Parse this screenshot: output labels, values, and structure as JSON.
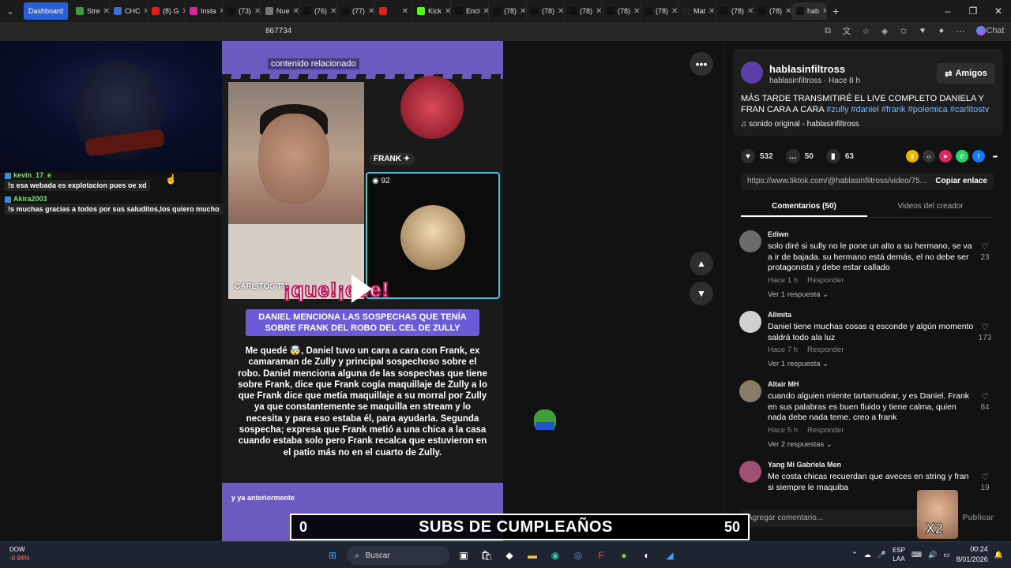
{
  "browser": {
    "tabs": [
      {
        "label": "Dashboard",
        "group": true,
        "color": "#2b5fd9"
      },
      {
        "label": "Stre",
        "color": "#3a9d3a"
      },
      {
        "label": "CHC",
        "color": "#3a6fd8"
      },
      {
        "label": "(8) G",
        "color": "#e02020"
      },
      {
        "label": "Insta",
        "color": "#d6249f"
      },
      {
        "label": "(73)",
        "color": "#111111"
      },
      {
        "label": "Nue",
        "color": "#777777"
      },
      {
        "label": "(76)",
        "color": "#111111"
      },
      {
        "label": "(77)",
        "color": "#111111"
      },
      {
        "label": "",
        "color": "#e02020"
      },
      {
        "label": "Kick",
        "color": "#53fc18"
      },
      {
        "label": "Enci",
        "color": "#111111"
      },
      {
        "label": "(78)",
        "color": "#111111"
      },
      {
        "label": "(78)",
        "color": "#111111"
      },
      {
        "label": "(78)",
        "color": "#111111"
      },
      {
        "label": "(78)",
        "color": "#111111"
      },
      {
        "label": "(78)",
        "color": "#111111"
      },
      {
        "label": "Mat",
        "color": "#222222"
      },
      {
        "label": "(78)",
        "color": "#111111"
      },
      {
        "label": "(78)",
        "color": "#111111"
      },
      {
        "label": "hab",
        "active": true,
        "color": "#111111"
      }
    ],
    "url_fragment": "867734",
    "chat_label": "Chat"
  },
  "stream_chat": [
    {
      "user": "kevin_17_e",
      "message": "!s esa webada es explotacion pues oe xd"
    },
    {
      "user": "Akira2003",
      "message": "!s muchas gracias a todos por sus saluditos,los quiero mucho"
    }
  ],
  "video": {
    "related_label": "contenido relacionado",
    "streamer_label": "CARLITOS TV",
    "frank_label": "FRANK",
    "viewer_count": "92",
    "sticker": "¡que!¡eee!",
    "headline": "DANIEL MENCIONA LAS SOSPECHAS QUE TENÍA SOBRE FRANK DEL ROBO DEL CEL DE ZULLY",
    "body": "Me quedé 🤯, Daniel tuvo un cara a cara con Frank, ex camaraman de Zully y principal sospechoso sobre el robo. Daniel menciona alguna de las sospechas que tiene sobre Frank, dice que Frank cogía maquillaje de Zully a lo que Frank dice que metía maquillaje a su morral por Zully ya que constantemente se maquilla en stream y lo necesita y para eso estaba él, para ayudarla. Segunda sospecha; expresa que Frank metió a una chica a la casa cuando estaba solo pero Frank recalca que estuvieron en el patio más no en el cuarto de Zully.",
    "bottom_text": "y ya anteriormente"
  },
  "subs_bar": {
    "left": "0",
    "title": "SUBS DE CUMPLEAÑOS",
    "right": "50"
  },
  "panel": {
    "author": "hablasinfiltross",
    "author_sub": "hablasinfiltross",
    "time": "Hace 8 h",
    "follow_label": "Amigos",
    "description_plain": "MÁS TARDE TRANSMITIRÉ EL LIVE COMPLETO DANIELA Y FRAN CARA A CARA ",
    "hashtags": [
      "#zully",
      "#daniel",
      "#frank",
      "#polemica",
      "#carlitostv"
    ],
    "music": "sonido original - hablasinfiltross",
    "likes": "532",
    "comments": "50",
    "saves": "63",
    "link": "https://www.tiktok.com/@hablasinfiltross/video/75...",
    "copy_label": "Copiar enlace",
    "tab_comments": "Comentarios (50)",
    "tab_creator": "Videos del creador",
    "comment_list": [
      {
        "user": "Ediwn",
        "text": "solo diré si sully no le pone un alto a su hermano, se va a ir de bajada. su hermano está demás, el no debe ser protagonista y debe estar callado",
        "time": "Hace 1 h",
        "reply": "Responder",
        "more": "Ver 1 respuesta",
        "likes": "23",
        "avatar": "#6b6b6b"
      },
      {
        "user": "Allmita",
        "text": "Daniel tiene muchas cosas q esconde y algún momento saldrá todo ala luz",
        "time": "Hace 7 h",
        "reply": "Responder",
        "more": "Ver 1 respuesta",
        "likes": "173",
        "avatar": "#d0d0d0"
      },
      {
        "user": "Altair MH",
        "text": "cuando alguien miente tartamudear, y es Daniel. Frank en sus palabras es buen fluido y tiene calma, quien nada debe nada teme. creo a frank",
        "time": "Hace 5 h",
        "reply": "Responder",
        "more": "Ver 2 respuestas",
        "likes": "84",
        "avatar": "#8a7a6a"
      },
      {
        "user": "Yang Mi Gabriela Men",
        "text": "Me costa chicas recuerdan que aveces en string y fran si siempre le maquiba",
        "time": "",
        "reply": "",
        "more": "",
        "likes": "19",
        "avatar": "#a05070"
      }
    ],
    "input_placeholder": "Agregar comentario...",
    "post_label": "Publicar",
    "overlay_badge": "X2"
  },
  "taskbar": {
    "ticker": "DOW",
    "ticker_change": "-0.94%",
    "search_label": "Buscar",
    "lang": "ESP",
    "lang2": "LAA",
    "time": "00:24",
    "date": "8/01/2026"
  }
}
